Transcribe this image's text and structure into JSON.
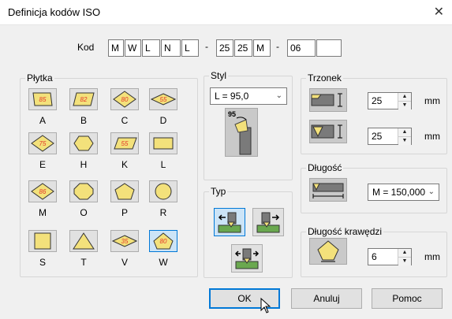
{
  "window": {
    "title": "Definicja kodów ISO",
    "close_icon": "close-icon"
  },
  "code": {
    "label": "Kod",
    "part1": [
      "M",
      "W",
      "L",
      "N",
      "L"
    ],
    "sep": "-",
    "part2": [
      "25",
      "25",
      "M"
    ],
    "part3": [
      "06",
      ""
    ]
  },
  "plytka": {
    "title": "Płytka",
    "inserts": [
      {
        "letter": "A",
        "badge": "85",
        "shape": "parallelogram-square",
        "selected": false
      },
      {
        "letter": "B",
        "badge": "82",
        "shape": "parallelogram",
        "selected": false
      },
      {
        "letter": "C",
        "badge": "80",
        "shape": "rhombus",
        "selected": false
      },
      {
        "letter": "D",
        "badge": "55",
        "shape": "rhombus-thin",
        "selected": false
      },
      {
        "letter": "E",
        "badge": "75",
        "shape": "rhombus",
        "selected": false
      },
      {
        "letter": "H",
        "badge": "",
        "shape": "hexagon",
        "selected": false
      },
      {
        "letter": "K",
        "badge": "55",
        "shape": "parallelogram-long",
        "selected": false
      },
      {
        "letter": "L",
        "badge": "",
        "shape": "rectangle",
        "selected": false
      },
      {
        "letter": "M",
        "badge": "86",
        "shape": "rhombus",
        "selected": false
      },
      {
        "letter": "O",
        "badge": "",
        "shape": "octagon",
        "selected": false
      },
      {
        "letter": "P",
        "badge": "",
        "shape": "pentagon",
        "selected": false
      },
      {
        "letter": "R",
        "badge": "",
        "shape": "circle",
        "selected": false
      },
      {
        "letter": "S",
        "badge": "",
        "shape": "square",
        "selected": false
      },
      {
        "letter": "T",
        "badge": "",
        "shape": "triangle",
        "selected": false
      },
      {
        "letter": "V",
        "badge": "35",
        "shape": "rhombus-thin",
        "selected": false
      },
      {
        "letter": "W",
        "badge": "80",
        "shape": "trigon",
        "selected": true
      }
    ]
  },
  "styl": {
    "title": "Styl",
    "value": "L = 95,0",
    "diagram_label": "95"
  },
  "typ": {
    "title": "Typ"
  },
  "trzonek": {
    "title": "Trzonek",
    "height_value": "25",
    "width_value": "25",
    "unit": "mm"
  },
  "dlugosc": {
    "title": "Długość",
    "value": "M = 150,000"
  },
  "dlugosc_krawedzi": {
    "title": "Długość krawędzi",
    "value": "6",
    "unit": "mm"
  },
  "buttons": {
    "ok": "OK",
    "cancel": "Anuluj",
    "help": "Pomoc"
  },
  "colors": {
    "insert_fill": "#f3e17b",
    "insert_badge": "#e33a2b",
    "selected_bg": "#cce4f7",
    "accent": "#0078d7"
  }
}
